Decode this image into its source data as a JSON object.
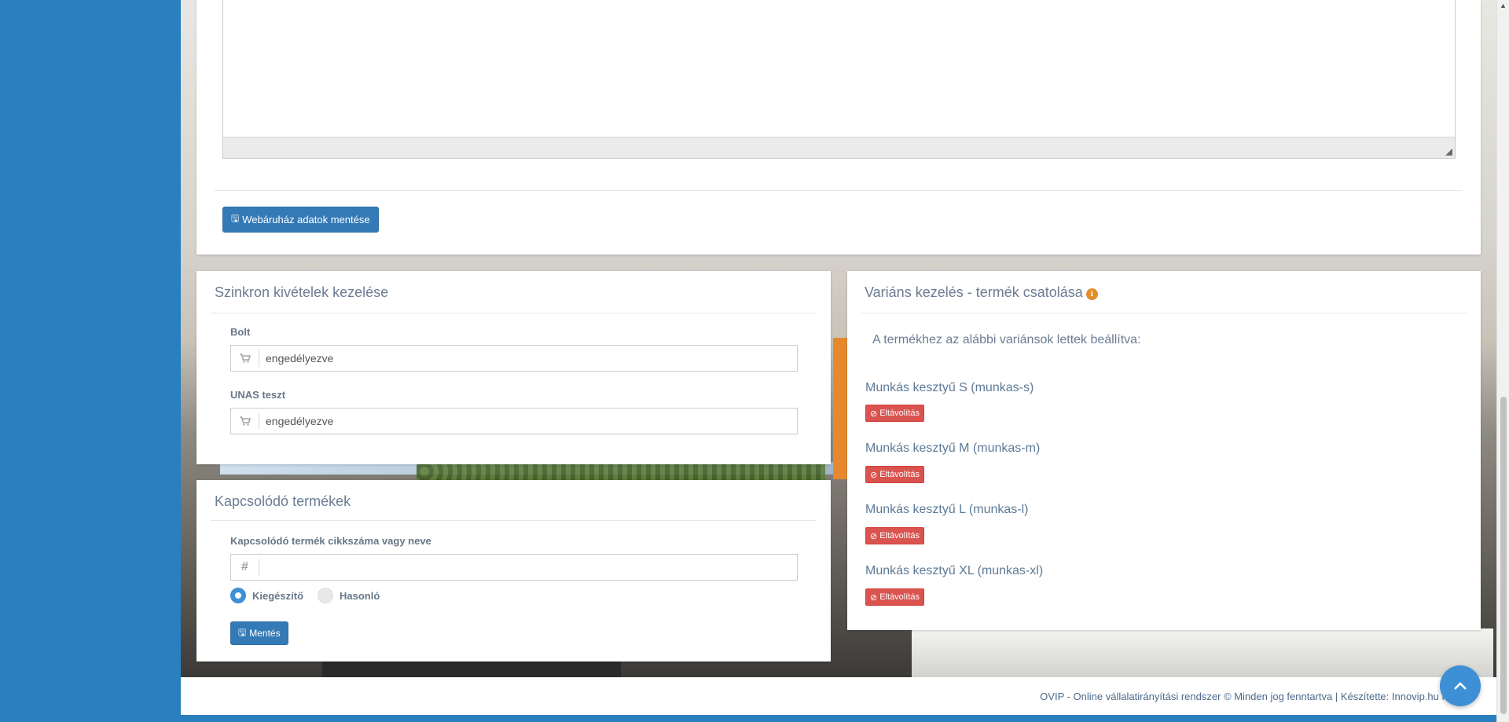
{
  "top_panel": {
    "save_button_label": "Webáruház adatok mentése"
  },
  "sync_panel": {
    "title": "Szinkron kivételek kezelése",
    "fields": [
      {
        "label": "Bolt",
        "value": "engedélyezve",
        "icon": "shopping-cart-icon"
      },
      {
        "label": "UNAS teszt",
        "value": "engedélyezve",
        "icon": "shopping-cart-icon"
      }
    ]
  },
  "related_panel": {
    "title": "Kapcsolódó termékek",
    "field_label": "Kapcsolódó termék cikkszáma vagy neve",
    "field_value": "",
    "field_icon": "hash-icon",
    "radio_options": [
      {
        "label": "Kiegészítő",
        "selected": true
      },
      {
        "label": "Hasonló",
        "selected": false
      }
    ],
    "save_label": "Mentés"
  },
  "variant_panel": {
    "title": "Variáns kezelés - termék csatolása",
    "intro": "A termékhez az alábbi variánsok lettek beállítva:",
    "remove_label": "Eltávolítás",
    "variants": [
      {
        "name": "Munkás kesztyű S (munkas-s)"
      },
      {
        "name": "Munkás kesztyű M (munkas-m)"
      },
      {
        "name": "Munkás kesztyű L (munkas-l)"
      },
      {
        "name": "Munkás kesztyű XL (munkas-xl)"
      }
    ]
  },
  "footer": {
    "text": "OVIP - Online vállalatirányítási rendszer © Minden jog fenntartva | Készítette: Innovip.hu Kft."
  },
  "colors": {
    "sidebar": "#2a7fbf",
    "primary": "#337ab7",
    "danger": "#d9534f",
    "info_icon": "#e08e2b"
  }
}
